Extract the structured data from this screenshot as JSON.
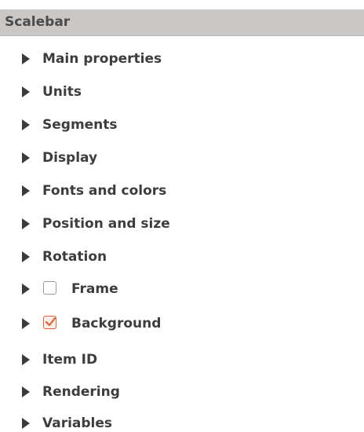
{
  "panel": {
    "title": "Scalebar"
  },
  "groups": [
    {
      "label": "Main properties"
    },
    {
      "label": "Units"
    },
    {
      "label": "Segments"
    },
    {
      "label": "Display"
    },
    {
      "label": "Fonts and colors"
    },
    {
      "label": "Position and size"
    },
    {
      "label": "Rotation"
    },
    {
      "label": "Frame",
      "checkable": true,
      "checked": false
    },
    {
      "label": "Background",
      "checkable": true,
      "checked": true
    },
    {
      "label": "Item ID"
    },
    {
      "label": "Rendering"
    },
    {
      "label": "Variables"
    }
  ],
  "colors": {
    "header_bg": "#c9c8c6",
    "text": "#3d3d3d",
    "checkbox_accent": "#d9633c"
  },
  "icons": {
    "expand": "triangle-right-icon",
    "check": "checkmark-icon"
  }
}
